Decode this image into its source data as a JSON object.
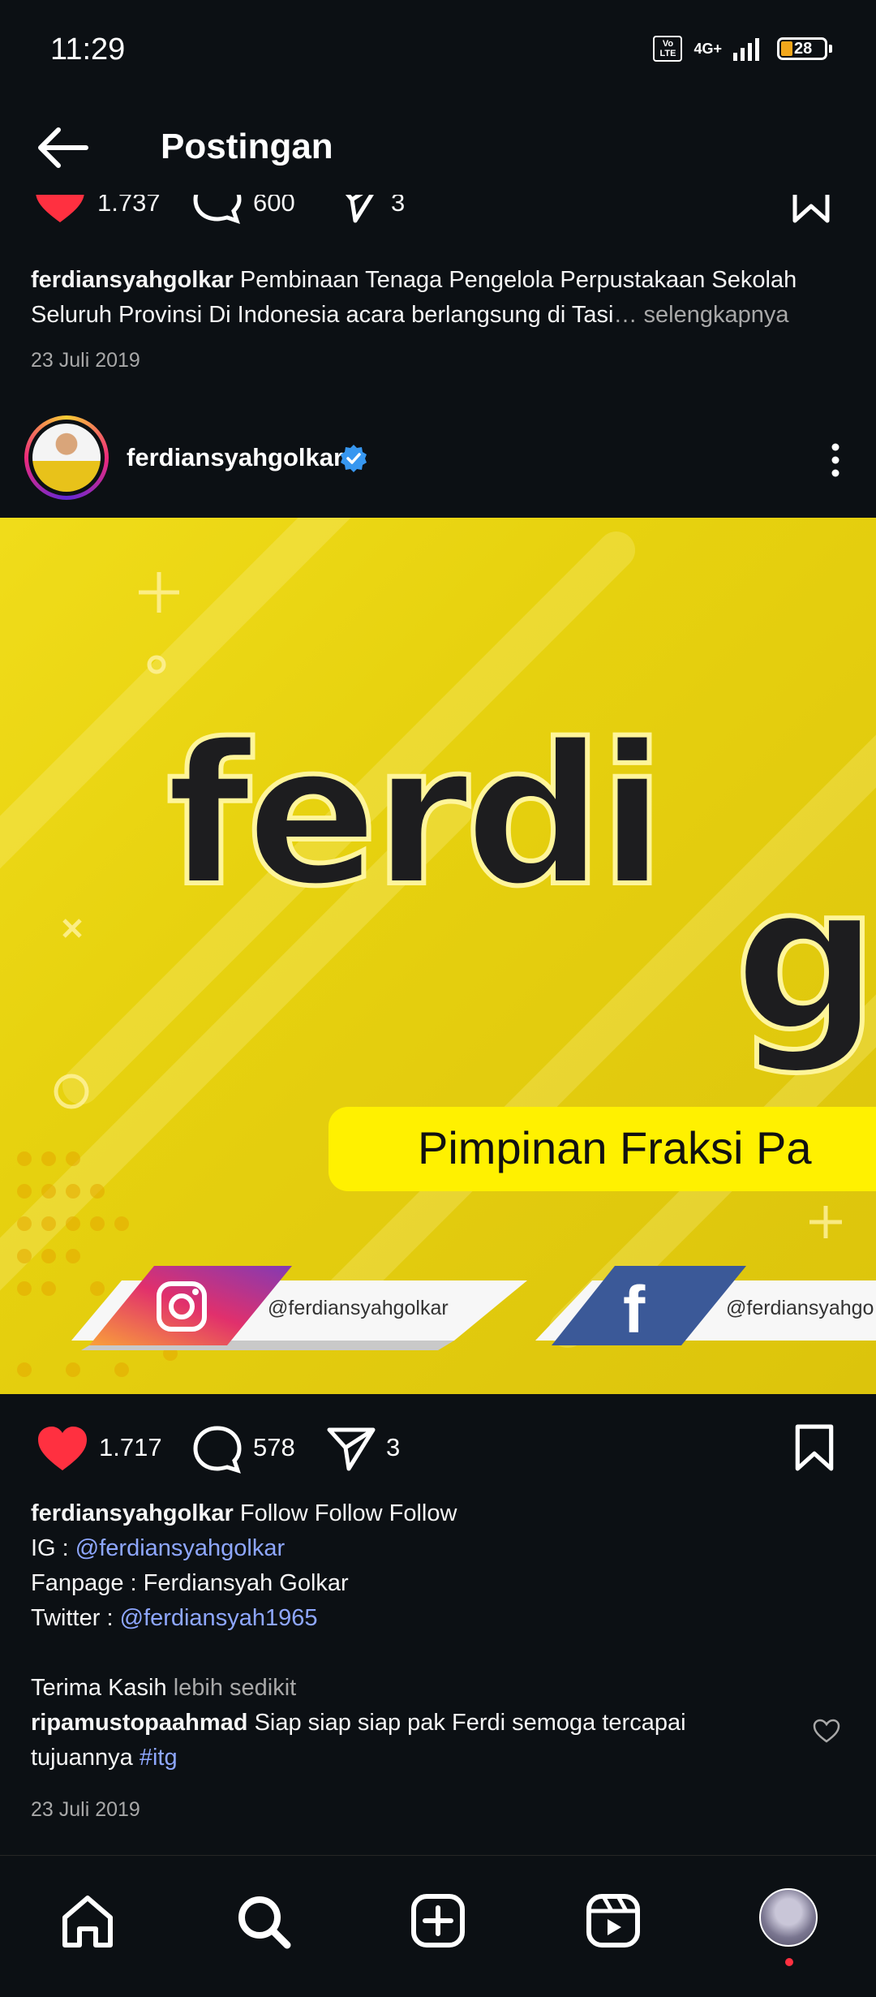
{
  "status_bar": {
    "time": "11:29",
    "volte": "Vo LTE",
    "network": "4G+",
    "battery": "28"
  },
  "header": {
    "title": "Postingan",
    "back_icon": "arrow-left-icon"
  },
  "previous_post": {
    "likes": "1.737",
    "comments": "600",
    "shares": "3",
    "caption_user": "ferdiansyahgolkar",
    "caption_text": "Pembinaan Tenaga Pengelola Perpustakaan Sekolah Seluruh Provinsi Di Indonesia acara berlangsung di Tasi",
    "caption_more": "… selengkapnya",
    "date": "23 Juli 2019"
  },
  "post": {
    "username": "ferdiansyahgolkar",
    "image": {
      "headline": "ferdi",
      "subline": "g",
      "banner_text": "Pimpinan Fraksi Pa",
      "instagram_handle": "@ferdiansyahgolkar",
      "facebook_handle": "@ferdiansyahgo"
    },
    "likes": "1.717",
    "comments": "578",
    "shares": "3",
    "caption_user": "ferdiansyahgolkar",
    "caption_line1": "Follow Follow Follow",
    "ig_label": "IG : ",
    "ig_handle": "@ferdiansyahgolkar",
    "fanpage": "Fanpage : Ferdiansyah Golkar",
    "twitter_label": "Twitter : ",
    "twitter_handle": "@ferdiansyah1965",
    "thanks": "Terima Kasih",
    "less": "lebih sedikit",
    "comment_user": "ripamustopaahmad",
    "comment_text": "Siap siap siap pak Ferdi semoga tercapai tujuannya",
    "comment_tag": "#itg",
    "date": "23 Juli 2019"
  },
  "bottom_nav": [
    "home-icon",
    "search-icon",
    "create-icon",
    "reels-icon",
    "profile-avatar"
  ],
  "colors": {
    "background": "#0c1014",
    "like_red": "#ff3040",
    "link_blue": "#8ea7ff",
    "verified_blue": "#3797f0",
    "banner_yellow": "#e7d20f"
  }
}
